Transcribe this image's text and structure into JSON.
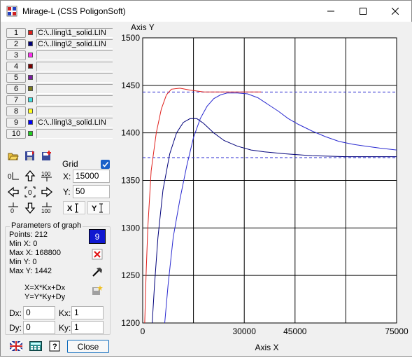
{
  "window": {
    "title": "Mirage-L (CSS PoligonSoft)"
  },
  "files": [
    {
      "num": "1",
      "color": "#e0201c",
      "path": "C:\\..lling\\1_solid.LIN"
    },
    {
      "num": "2",
      "color": "#00007a",
      "path": "C:\\..lling\\2_solid.LIN"
    },
    {
      "num": "3",
      "color": "#ff2ef0",
      "path": ""
    },
    {
      "num": "4",
      "color": "#7a0000",
      "path": ""
    },
    {
      "num": "5",
      "color": "#7a1aa0",
      "path": ""
    },
    {
      "num": "6",
      "color": "#7a7a1a",
      "path": ""
    },
    {
      "num": "7",
      "color": "#3fe0e0",
      "path": ""
    },
    {
      "num": "8",
      "color": "#ffff20",
      "path": ""
    },
    {
      "num": "9",
      "color": "#0000ff",
      "path": "C:\\..lling\\3_solid.LIN"
    },
    {
      "num": "10",
      "color": "#20d020",
      "path": ""
    }
  ],
  "controls": {
    "grid_label": "Grid",
    "grid_checked": true,
    "x_label": "X:",
    "x_value": "15000",
    "y_label": "Y:",
    "y_value": "50",
    "zero_icon_label": "0",
    "hundred_label": "100"
  },
  "params": {
    "title": "Parameters of graph",
    "points": "Points: 212",
    "min_x": "Min  X: 0",
    "max_x": "Max X: 168800",
    "min_y": "Min  Y: 0",
    "max_y": "Max Y: 1442",
    "formula_x": "X=X*Kx+Dx",
    "formula_y": "Y=Y*Ky+Dy",
    "dx_label": "Dx:",
    "dx_value": "0",
    "dy_label": "Dy:",
    "dy_value": "0",
    "kx_label": "Kx:",
    "kx_value": "1",
    "ky_label": "Ky:",
    "ky_value": "1",
    "selected_num": "9"
  },
  "bottom": {
    "close_label": "Close"
  },
  "chart_data": {
    "type": "line",
    "xlabel": "Axis X",
    "ylabel": "Axis Y",
    "xlim": [
      0,
      75000
    ],
    "ylim": [
      1200,
      1500
    ],
    "x_ticks": [
      0,
      30000,
      45000,
      75000
    ],
    "x_grid": [
      15000,
      30000,
      45000,
      60000
    ],
    "y_ticks": [
      1200,
      1250,
      1300,
      1350,
      1400,
      1450,
      1500
    ],
    "grid": true,
    "hlines": [
      {
        "y": 1443,
        "color": "#2a2ad0",
        "style": "dashed"
      },
      {
        "y": 1374,
        "color": "#2a2ad0",
        "style": "dashed"
      }
    ],
    "series": [
      {
        "color": "#e0201c",
        "points": [
          [
            600,
            1200
          ],
          [
            1000,
            1250
          ],
          [
            1500,
            1300
          ],
          [
            2500,
            1360
          ],
          [
            4000,
            1400
          ],
          [
            5500,
            1425
          ],
          [
            7000,
            1440
          ],
          [
            8500,
            1446
          ],
          [
            11000,
            1447
          ],
          [
            14000,
            1445
          ],
          [
            18000,
            1443
          ],
          [
            25000,
            1443
          ],
          [
            35000,
            1443
          ]
        ]
      },
      {
        "color": "#00007a",
        "points": [
          [
            2800,
            1200
          ],
          [
            3500,
            1240
          ],
          [
            4500,
            1290
          ],
          [
            6000,
            1340
          ],
          [
            8000,
            1378
          ],
          [
            10000,
            1400
          ],
          [
            12000,
            1411
          ],
          [
            14000,
            1415
          ],
          [
            16000,
            1415
          ],
          [
            18000,
            1410
          ],
          [
            21000,
            1400
          ],
          [
            24000,
            1392
          ],
          [
            28000,
            1386
          ],
          [
            32000,
            1382
          ],
          [
            36000,
            1380
          ],
          [
            42000,
            1378
          ],
          [
            50000,
            1376
          ],
          [
            60000,
            1375
          ],
          [
            75000,
            1375
          ]
        ]
      },
      {
        "color": "#2a2ad0",
        "points": [
          [
            6500,
            1200
          ],
          [
            7500,
            1240
          ],
          [
            9000,
            1290
          ],
          [
            11000,
            1330
          ],
          [
            13000,
            1365
          ],
          [
            15000,
            1395
          ],
          [
            17000,
            1415
          ],
          [
            19000,
            1428
          ],
          [
            21000,
            1436
          ],
          [
            23000,
            1440
          ],
          [
            25000,
            1442
          ],
          [
            28000,
            1442
          ],
          [
            31000,
            1441
          ],
          [
            34000,
            1437
          ],
          [
            37000,
            1430
          ],
          [
            40000,
            1423
          ],
          [
            43000,
            1415
          ],
          [
            46000,
            1409
          ],
          [
            50000,
            1402
          ],
          [
            54000,
            1396
          ],
          [
            58000,
            1391
          ],
          [
            62000,
            1388
          ],
          [
            66000,
            1386
          ],
          [
            70000,
            1384
          ],
          [
            75000,
            1382
          ]
        ]
      }
    ]
  }
}
